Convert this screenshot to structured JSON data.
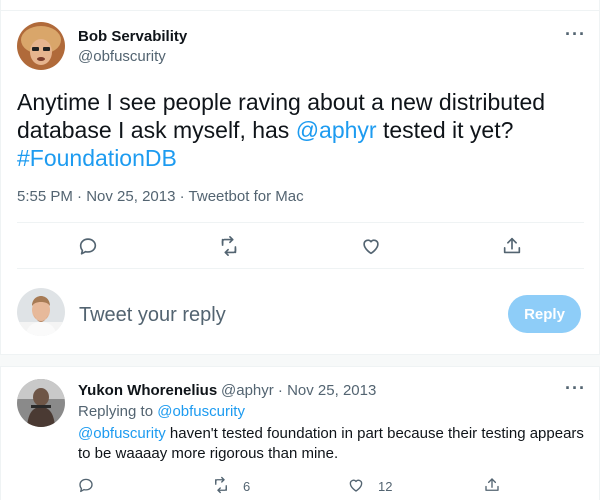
{
  "main_tweet": {
    "author_name": "Bob Servability",
    "author_handle": "@obfuscurity",
    "text_before": "Anytime I see people raving about a new distributed database I ask myself, has ",
    "mention": "@aphyr",
    "text_middle": " tested it yet? ",
    "hashtag": "#FoundationDB",
    "time": "5:55 PM",
    "date": "Nov 25, 2013",
    "source": "Tweetbot for Mac",
    "sep": "·",
    "more": "···"
  },
  "reply_box": {
    "placeholder": "Tweet your reply",
    "button_label": "Reply"
  },
  "reply_tweet": {
    "author_name": "Yukon Whorenelius",
    "author_handle": "@aphyr",
    "sep": "·",
    "date": "Nov 25, 2013",
    "replying_to_label": "Replying to ",
    "replying_to_handle": "@obfuscurity",
    "mention": "@obfuscurity",
    "text": " haven't tested foundation in part because their testing appears to be waaaay more rigorous than mine.",
    "retweet_count": "6",
    "like_count": "12",
    "more": "···"
  },
  "icons": {
    "reply": "reply-icon",
    "retweet": "retweet-icon",
    "like": "heart-icon",
    "share": "share-icon",
    "more": "more-icon"
  },
  "colors": {
    "link": "#1d9bf0",
    "text": "#0f1419",
    "secondary": "#536471",
    "reply_button": "#8ecdf8"
  }
}
